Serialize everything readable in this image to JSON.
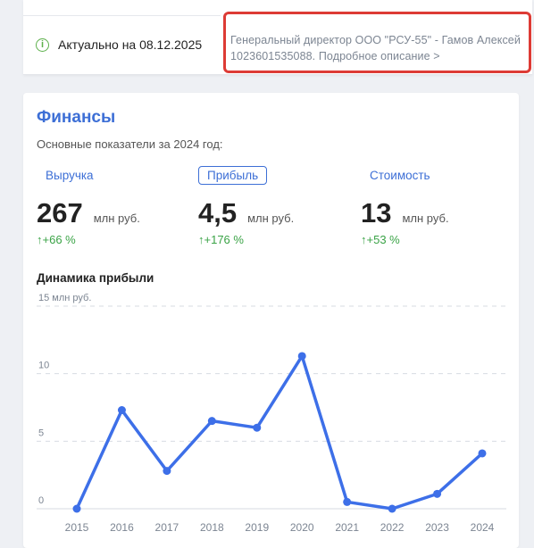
{
  "header": {
    "actual_label": "Актуально на 08.12.2025",
    "notice_line1": "Генеральный директор ООО \"РСУ-55\" - Гамов Алексей",
    "notice_line2_code": "1023601535088.",
    "notice_link": "Подробное описание >"
  },
  "finance": {
    "title": "Финансы",
    "subtitle": "Основные показатели за 2024 год:",
    "metrics": [
      {
        "tab": "Выручка",
        "value": "267",
        "unit": "млн руб.",
        "change": "+66 %"
      },
      {
        "tab": "Прибыль",
        "value": "4,5",
        "unit": "млн руб.",
        "change": "+176 %"
      },
      {
        "tab": "Стоимость",
        "value": "13",
        "unit": "млн руб.",
        "change": "+53 %"
      }
    ],
    "active_tab": "Прибыль",
    "dynamics_title": "Динамика прибыли"
  },
  "chart_data": {
    "type": "line",
    "title": "Динамика прибыли",
    "y_unit_label": "15 млн руб.",
    "ylim": [
      0,
      15
    ],
    "yticks": [
      "0",
      "5",
      "10",
      "15 млн руб."
    ],
    "categories": [
      "2015",
      "2016",
      "2017",
      "2018",
      "2019",
      "2020",
      "2021",
      "2022",
      "2023",
      "2024"
    ],
    "series": [
      {
        "values": [
          0.0,
          7.3,
          2.8,
          6.5,
          6.0,
          11.3,
          0.5,
          0.0,
          1.1,
          4.1
        ]
      }
    ],
    "grid": true,
    "color": "#3d6fe8"
  },
  "colors": {
    "accent": "#3d6fd6",
    "positive": "#3aa346",
    "highlight": "#dd3b35"
  }
}
